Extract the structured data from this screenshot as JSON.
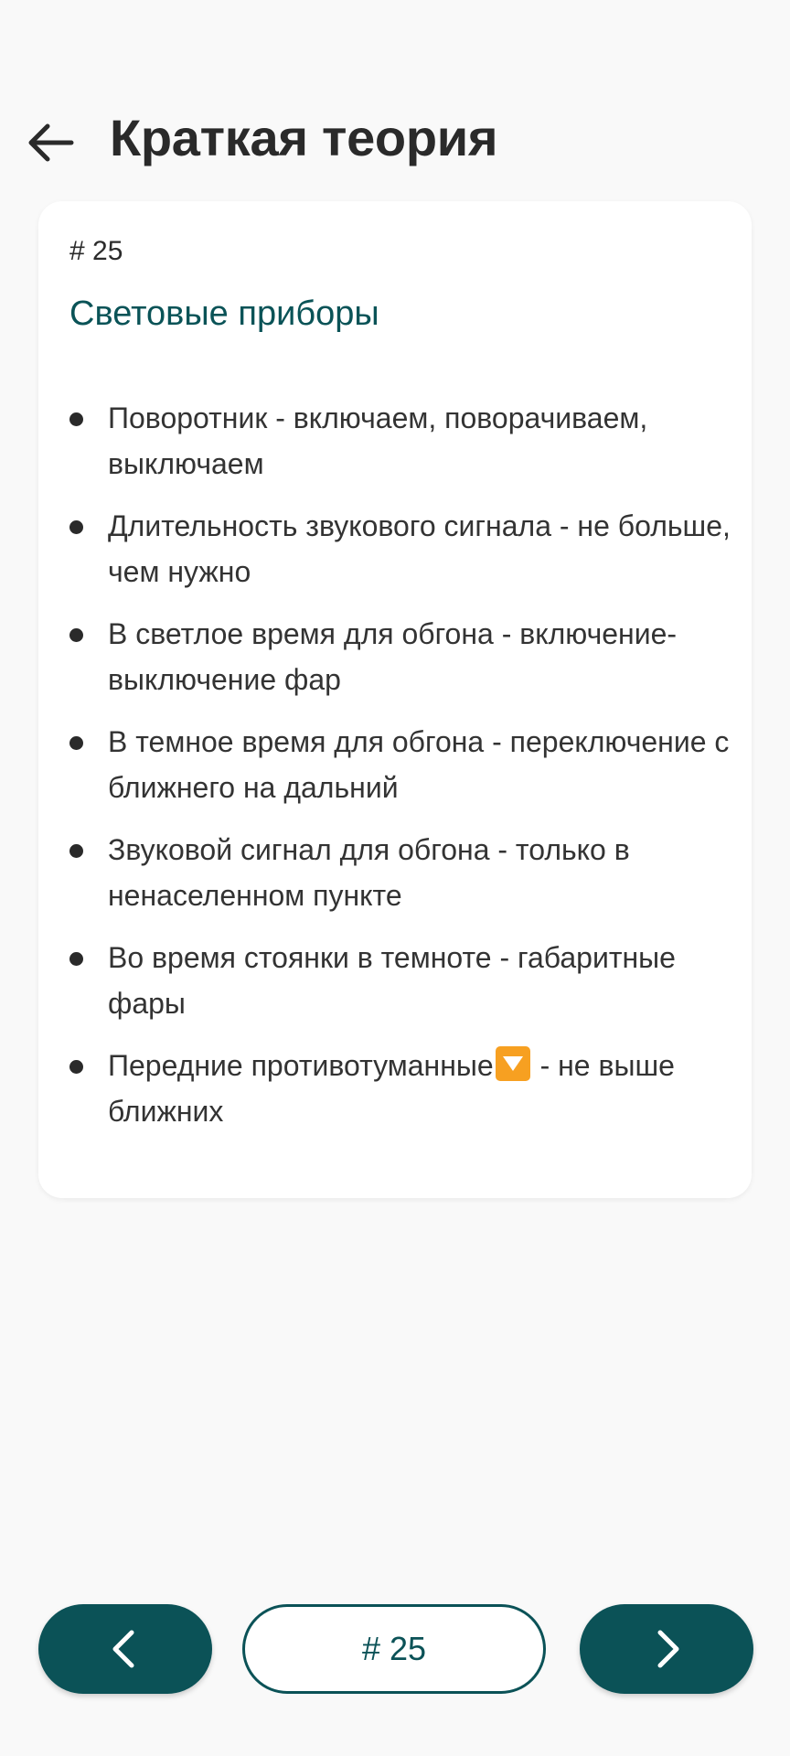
{
  "header": {
    "title": "Краткая теория",
    "back_icon": "arrow-left-icon"
  },
  "card": {
    "number": "# 25",
    "title": "Световые приборы",
    "items": [
      {
        "text": "Поворотник - включаем, поворачиваем, выключаем"
      },
      {
        "text": "Длительность звукового сигнала - не больше, чем нужно"
      },
      {
        "text": "В светлое время для обгона - включение-выключение фар"
      },
      {
        "text": "В темное время для обгона - переключение с ближнего на дальний"
      },
      {
        "text": "Звуковой сигнал для обгона - только в ненаселенном пункте"
      },
      {
        "text": "Во время стоянки в темноте - габаритные фары"
      },
      {
        "text_before": "Передние противотуманные",
        "emoji": "down-arrow-emoji",
        "text_after": " - не выше ближних"
      }
    ]
  },
  "nav": {
    "counter_label": "# 25",
    "prev_icon": "chevron-left-icon",
    "next_icon": "chevron-right-icon"
  },
  "colors": {
    "accent": "#0b5257",
    "title_accent": "#0a5357",
    "background": "#f9f9f9",
    "card": "#ffffff",
    "emoji": "#f7a021"
  }
}
